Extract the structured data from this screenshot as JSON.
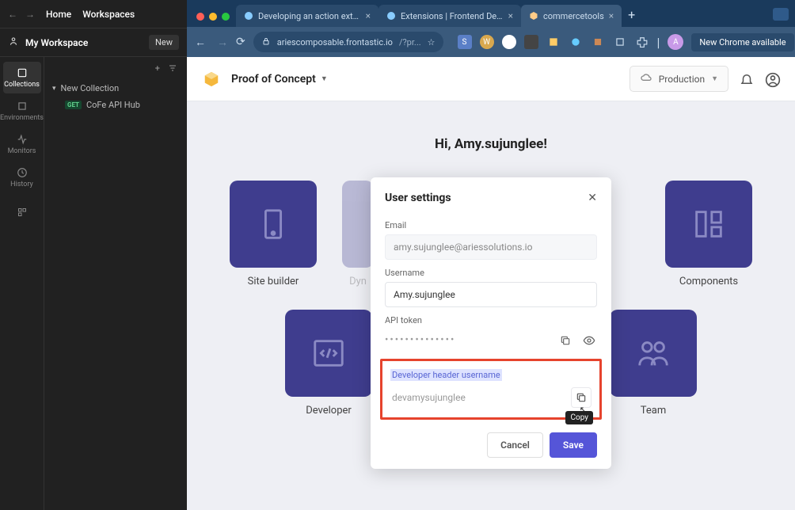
{
  "postman": {
    "home": "Home",
    "workspaces": "Workspaces",
    "workspace_name": "My Workspace",
    "new_btn": "New",
    "rail": {
      "collections": "Collections",
      "environments": "Environments",
      "monitors": "Monitors",
      "history": "History"
    },
    "collection_name": "New Collection",
    "request_method": "GET",
    "request_name": "CoFe API Hub"
  },
  "browser": {
    "tabs": [
      {
        "label": "Developing an action extensi"
      },
      {
        "label": "Extensions | Frontend Develo"
      },
      {
        "label": "commercetools"
      }
    ],
    "url_host": "ariescomposable.frontastic.io",
    "url_path": "/?pr...",
    "new_chrome": "New Chrome available",
    "ext_letters": {
      "s": "S",
      "w": "W",
      "a": "A"
    }
  },
  "page": {
    "title": "Proof of Concept",
    "env": "Production",
    "greeting": "Hi, Amy.sujunglee!",
    "tiles": {
      "site_builder": "Site builder",
      "dyn": "Dyn",
      "components": "Components",
      "developer": "Developer",
      "team": "Team"
    }
  },
  "modal": {
    "title": "User settings",
    "email_label": "Email",
    "email_value": "amy.sujunglee@ariessolutions.io",
    "username_label": "Username",
    "username_value": "Amy.sujunglee",
    "token_label": "API token",
    "token_mask": "••••••••••••••",
    "dev_label": "Developer header username",
    "dev_value": "devamysujunglee",
    "copy_tooltip": "Copy",
    "cancel": "Cancel",
    "save": "Save"
  }
}
